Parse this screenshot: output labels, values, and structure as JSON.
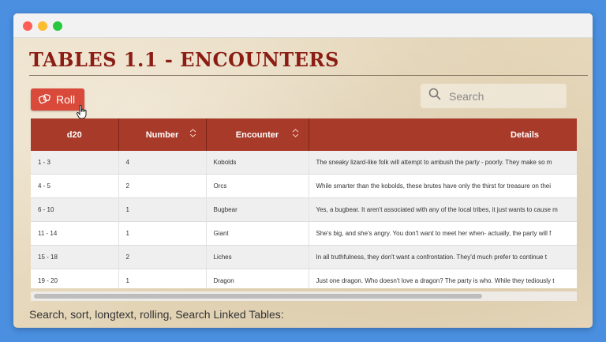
{
  "page": {
    "title": "TABLES 1.1 - ENCOUNTERS",
    "footer_text": "Search, sort, longtext, rolling, Search Linked Tables:"
  },
  "colors": {
    "title": "#8b1d14",
    "button": "#d94a3a",
    "table_header": "#a83a2a"
  },
  "toolbar": {
    "roll_label": "Roll",
    "roll_icon": "dice-icon"
  },
  "search": {
    "placeholder": "Search",
    "value": ""
  },
  "table": {
    "columns": [
      {
        "label": "d20",
        "sortable": false
      },
      {
        "label": "Number",
        "sortable": true
      },
      {
        "label": "Encounter",
        "sortable": true
      },
      {
        "label": "Details",
        "sortable": false
      }
    ],
    "rows": [
      {
        "d20": "1 - 3",
        "number": "4",
        "encounter": "Kobolds",
        "details": "The sneaky lizard-like folk will attempt to ambush the party - poorly. They make so m"
      },
      {
        "d20": "4 - 5",
        "number": "2",
        "encounter": "Orcs",
        "details": "While smarter than the kobolds, these brutes have only the thirst for treasure on thei"
      },
      {
        "d20": "6 - 10",
        "number": "1",
        "encounter": "Bugbear",
        "details": "Yes, a bugbear. It aren't associated with any of the local tribes, it just wants to cause m"
      },
      {
        "d20": "11 - 14",
        "number": "1",
        "encounter": "Giant",
        "details": "She's big, and she's angry. You don't want to meet her when- actually, the party will f"
      },
      {
        "d20": "15 - 18",
        "number": "2",
        "encounter": "Liches",
        "details": "In all truthfulness, they don't want a confrontation. They'd much prefer to continue t"
      },
      {
        "d20": "19 - 20",
        "number": "1",
        "encounter": "Dragon",
        "details": "Just one dragon. Who doesn't love a dragon? The party is who. While they tediously t"
      }
    ]
  }
}
